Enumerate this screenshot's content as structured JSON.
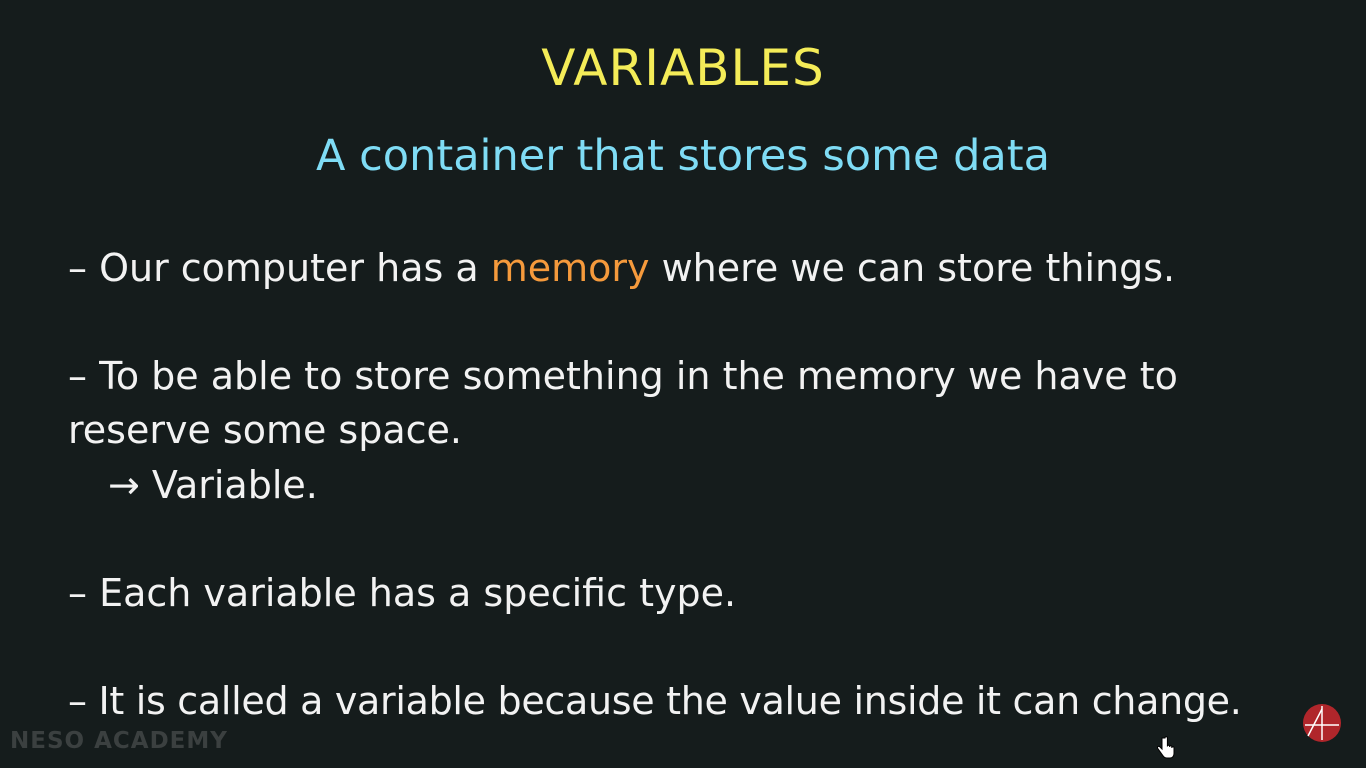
{
  "slide": {
    "title": "VARIABLES",
    "subtitle": "A container that stores some data",
    "bullets": {
      "b1_pre": "– Our computer has a ",
      "b1_highlight": "memory",
      "b1_post": " where we can store things.",
      "b2_line1": "– To be able to store something in the memory we have to",
      "b2_line2": "reserve some space.",
      "b2_arrow": "→ Variable.",
      "b3": "– Each variable has a specific type.",
      "b4": "– It is called a variable because the value inside it can change."
    },
    "watermark": "NESO ACADEMY",
    "colors": {
      "background": "#151c1c",
      "title": "#f4ec58",
      "subtitle": "#7fdcf5",
      "body": "#f2f2f2",
      "highlight": "#f59a3c",
      "logo": "#b0262b"
    },
    "icons": {
      "logo": "neso-logo-icon",
      "cursor": "hand-pointer-icon"
    }
  }
}
